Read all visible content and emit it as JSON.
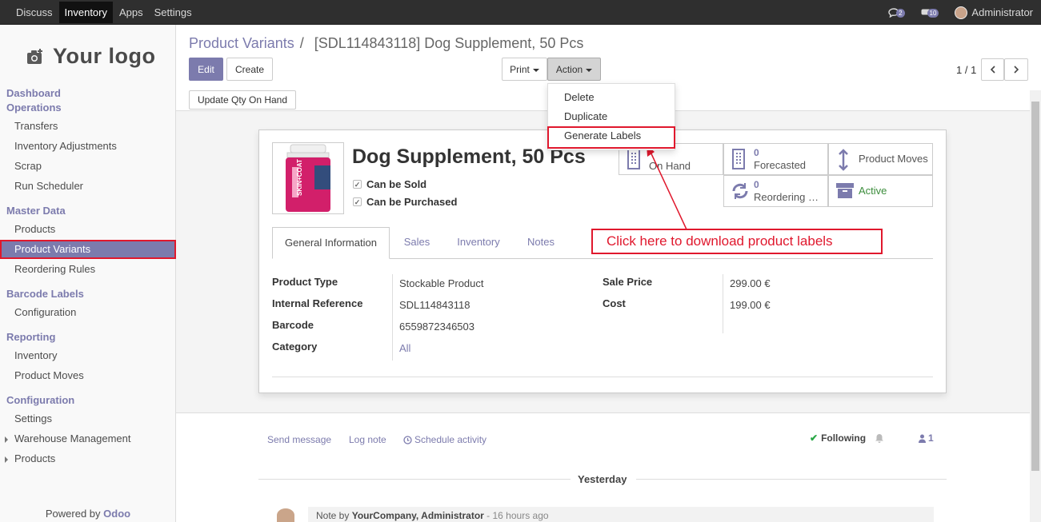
{
  "topbar": {
    "menu": [
      "Discuss",
      "Inventory",
      "Apps",
      "Settings"
    ],
    "active_menu": "Inventory",
    "messages_count": "2",
    "activities_count": "10",
    "user": "Administrator"
  },
  "sidebar": {
    "logo_text": "Your logo",
    "sections": {
      "dashboard": "Dashboard",
      "operations": "Operations",
      "master_data": "Master Data",
      "barcode_labels": "Barcode Labels",
      "reporting": "Reporting",
      "configuration": "Configuration"
    },
    "items": {
      "transfers": "Transfers",
      "inventory_adjustments": "Inventory Adjustments",
      "scrap": "Scrap",
      "run_scheduler": "Run Scheduler",
      "products": "Products",
      "product_variants": "Product Variants",
      "reordering_rules": "Reordering Rules",
      "barcode_configuration": "Configuration",
      "reporting_inventory": "Inventory",
      "product_moves": "Product Moves",
      "settings": "Settings",
      "warehouse_management": "Warehouse Management",
      "config_products": "Products"
    },
    "powered_by": "Powered by",
    "powered_brand": "Odoo"
  },
  "breadcrumb": {
    "parent": "Product Variants",
    "separator": "/",
    "current": "[SDL114843118] Dog Supplement, 50 Pcs"
  },
  "buttons": {
    "edit": "Edit",
    "create": "Create",
    "print": "Print",
    "action": "Action",
    "update_qty": "Update Qty On Hand"
  },
  "pager": "1 / 1",
  "action_menu": {
    "items": [
      "Delete",
      "Duplicate",
      "Generate Labels"
    ],
    "highlighted": "Generate Labels"
  },
  "product": {
    "name": "Dog Supplement, 50 Pcs",
    "can_be_sold": "Can be Sold",
    "can_be_purchased": "Can be Purchased",
    "image_text": "SKIN+COAT"
  },
  "stat_buttons": {
    "on_hand_label": "On Hand",
    "forecasted_value": "0",
    "forecasted_label": "Forecasted",
    "product_moves_label": "Product Moves",
    "reordering_value": "0",
    "reordering_label": "Reordering Rules",
    "active_label": "Active"
  },
  "tabs": [
    "General Information",
    "Sales",
    "Inventory",
    "Notes"
  ],
  "fields": {
    "product_type_label": "Product Type",
    "product_type": "Stockable Product",
    "internal_ref_label": "Internal Reference",
    "internal_ref": "SDL114843118",
    "barcode_label": "Barcode",
    "barcode": "6559872346503",
    "category_label": "Category",
    "category": "All",
    "sale_price_label": "Sale Price",
    "sale_price": "299.00 €",
    "cost_label": "Cost",
    "cost": "199.00 €"
  },
  "annotation": "Click here to download product labels",
  "chatter": {
    "send_message": "Send message",
    "log_note": "Log note",
    "schedule_activity": "Schedule activity",
    "following": "Following",
    "followers": "1",
    "day_divider": "Yesterday",
    "note_prefix": "Note by",
    "note_author": "YourCompany, Administrator",
    "note_time": "- 16 hours ago"
  },
  "colors": {
    "brand": "#7c7bad",
    "highlight_red": "#e0182d",
    "topbar": "#2f2f2f"
  }
}
